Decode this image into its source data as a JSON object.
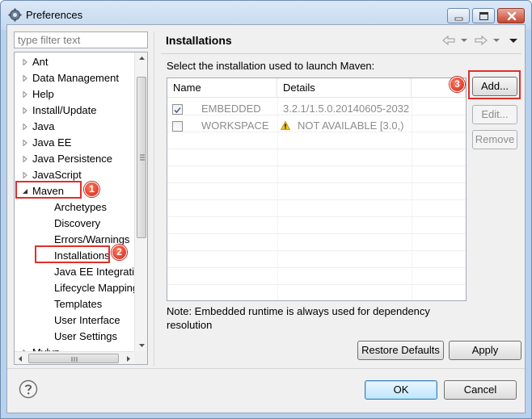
{
  "window": {
    "title": "Preferences"
  },
  "filter": {
    "placeholder": "type filter text"
  },
  "tree": {
    "items": [
      {
        "label": "Ant",
        "expandable": true
      },
      {
        "label": "Data Management",
        "expandable": true
      },
      {
        "label": "Help",
        "expandable": true
      },
      {
        "label": "Install/Update",
        "expandable": true
      },
      {
        "label": "Java",
        "expandable": true
      },
      {
        "label": "Java EE",
        "expandable": true
      },
      {
        "label": "Java Persistence",
        "expandable": true
      },
      {
        "label": "JavaScript",
        "expandable": true
      },
      {
        "label": "Maven",
        "expanded": true
      },
      {
        "label": "Archetypes",
        "child": true
      },
      {
        "label": "Discovery",
        "child": true
      },
      {
        "label": "Errors/Warnings",
        "child": true
      },
      {
        "label": "Installations",
        "child": true,
        "selected": true
      },
      {
        "label": "Java EE Integration",
        "child": true
      },
      {
        "label": "Lifecycle Mapping",
        "child": true
      },
      {
        "label": "Templates",
        "child": true
      },
      {
        "label": "User Interface",
        "child": true
      },
      {
        "label": "User Settings",
        "child": true
      },
      {
        "label": "Mylyn",
        "expandable": true
      }
    ]
  },
  "page": {
    "title": "Installations",
    "prompt": "Select the installation used to launch Maven:",
    "table": {
      "columns": [
        "Name",
        "Details"
      ],
      "rows": [
        {
          "checked": true,
          "name": "EMBEDDED",
          "details": "3.2.1/1.5.0.20140605-2032",
          "warning": false
        },
        {
          "checked": false,
          "name": "WORKSPACE",
          "details": "NOT AVAILABLE [3.0,)",
          "warning": true
        }
      ]
    },
    "buttons": {
      "add": "Add...",
      "edit": "Edit...",
      "remove": "Remove"
    },
    "note": "Note: Embedded runtime is always used for dependency resolution",
    "restore_defaults": "Restore Defaults",
    "apply": "Apply"
  },
  "footer": {
    "ok": "OK",
    "cancel": "Cancel"
  },
  "annotations": {
    "badge1": "1",
    "badge2": "2",
    "badge3": "3"
  },
  "colors": {
    "highlight": "#e0302a",
    "badge": "#d4241a",
    "accent": "#3c7fb1"
  }
}
